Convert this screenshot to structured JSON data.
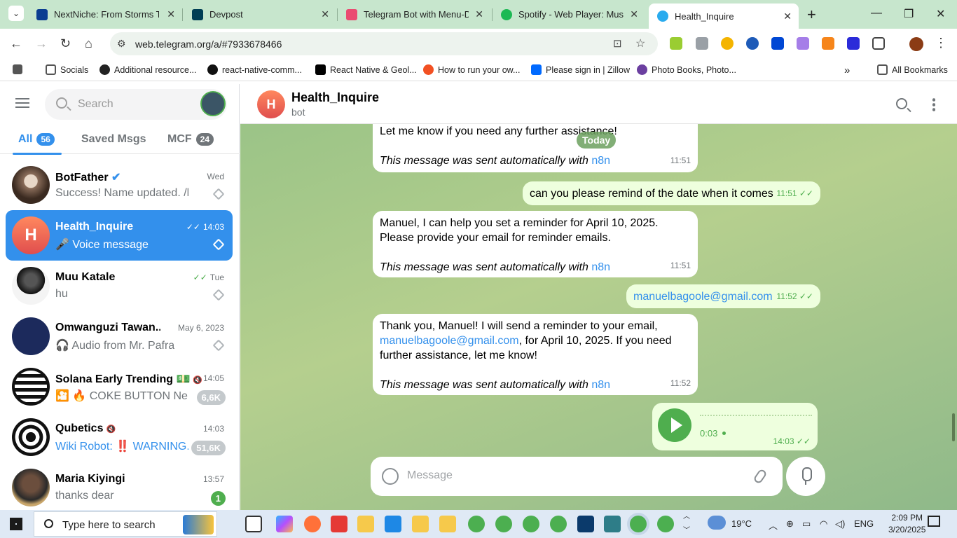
{
  "browser": {
    "tabs": [
      {
        "title": "NextNiche: From Storms To",
        "favicon_color": "#0b3d91"
      },
      {
        "title": "Devpost",
        "favicon_color": "#003e54"
      },
      {
        "title": "Telegram Bot with Menu-Dri",
        "favicon_color": "#ea4b71"
      },
      {
        "title": "Spotify - Web Player: Music",
        "favicon_color": "#1db954"
      },
      {
        "title": "Health_Inquire",
        "favicon_color": "#2aabee"
      }
    ],
    "url": "web.telegram.org/a/#7933678466",
    "bookmarks": [
      "Socials",
      "Additional resource...",
      "react-native-comm...",
      "React Native & Geol...",
      "How to run your ow...",
      "Please sign in | Zillow",
      "Photo Books, Photo..."
    ],
    "all_bookmarks": "All Bookmarks"
  },
  "sidebar": {
    "search_placeholder": "Search",
    "folders": [
      {
        "label": "All",
        "count": "56"
      },
      {
        "label": "Saved Msgs"
      },
      {
        "label": "MCF",
        "count": "24"
      }
    ],
    "chats": [
      {
        "name": "BotFather",
        "preview": "Success! Name updated. /h...",
        "time": "Wed",
        "avatar_color": "#8a6d5a"
      },
      {
        "name": "Health_Inquire",
        "preview": "🎤 Voice message",
        "time": "14:03",
        "avatar_color": "#e25d53",
        "avatar_letter": "H"
      },
      {
        "name": "Muu Katale",
        "preview": "hu",
        "time": "Tue",
        "avatar_color": "#1a1a1a"
      },
      {
        "name": "Omwanguzi Tawan...",
        "preview": "🎧 Audio from Mr. Pafra",
        "time": "May 6, 2023",
        "avatar_color": "#1c2a5c"
      },
      {
        "name": "Solana Early Trending 💵",
        "preview": "🎦 🔥 COKE BUTTON Ne...",
        "time": "14:05",
        "badge": "6,6K",
        "avatar_color": "#111111"
      },
      {
        "name": "Qubetics",
        "preview": "Wiki Robot: ‼️ WARNING...",
        "time": "14:03",
        "badge": "51,6K",
        "avatar_color": "#111111"
      },
      {
        "name": "Maria Kiyingi",
        "preview": "thanks dear",
        "time": "13:57",
        "badge": "1",
        "avatar_color": "#4a3a30"
      }
    ]
  },
  "chat": {
    "title": "Health_Inquire",
    "subtitle": "bot",
    "avatar_letter": "H",
    "day_label": "Today",
    "messages": [
      {
        "dir": "in",
        "text": "Let me know if you need any further assistance!",
        "auto": "This message was sent automatically with",
        "auto_link": "n8n",
        "time": "11:51"
      },
      {
        "dir": "out",
        "text": "can you please remind of the date when it comes",
        "time": "11:51 ✓✓"
      },
      {
        "dir": "in",
        "text": "Manuel, I can help you set a reminder for April 10, 2025. Please provide your email for reminder emails.",
        "auto": "This message was sent automatically with",
        "auto_link": "n8n",
        "time": "11:51"
      },
      {
        "dir": "out",
        "text": "manuelbagoole@gmail.com",
        "time": "11:52 ✓✓"
      },
      {
        "dir": "in",
        "text_a": "Thank you, Manuel! I will send a reminder to your email,",
        "email": "manuelbagoole@gmail.com",
        "text_b": ", for April 10, 2025. If you need further assistance, let me know!",
        "auto": "This message was sent automatically with",
        "auto_link": "n8n",
        "time": "11:52"
      }
    ],
    "voice": {
      "duration": "0:03",
      "time": "14:03 ✓✓"
    },
    "composer_placeholder": "Message"
  },
  "taskbar": {
    "search_placeholder": "Type here to search",
    "weather": "19°C",
    "language": "ENG",
    "time": "2:09 PM",
    "date": "3/20/2025"
  }
}
